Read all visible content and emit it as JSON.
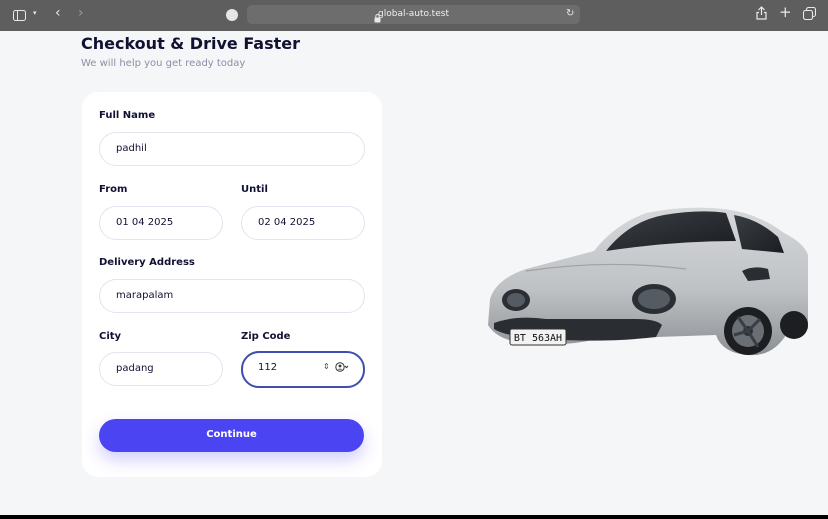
{
  "browser": {
    "url": "global-auto.test",
    "icons": {
      "sidebar": "sidebar-icon",
      "back": "back-icon",
      "forward": "forward-icon",
      "reload": "reload-icon",
      "share": "share-icon",
      "new_tab": "plus-icon",
      "tabs": "tabs-overview-icon"
    }
  },
  "page": {
    "title": "Checkout & Drive Faster",
    "subtitle": "We will help you get ready today"
  },
  "form": {
    "full_name_label": "Full Name",
    "full_name_value": "padhil",
    "from_label": "From",
    "from_value": "01 04 2025",
    "until_label": "Until",
    "until_value": "02 04 2025",
    "address_label": "Delivery Address",
    "address_value": "marapalam",
    "city_label": "City",
    "city_value": "padang",
    "zip_label": "Zip Code",
    "zip_value": "112",
    "continue_label": "Continue"
  },
  "car": {
    "plate": "BT 563AH",
    "color": "#c9ccd0"
  },
  "colors": {
    "accent": "#4b44f2",
    "title": "#111133",
    "background": "#f4f6f7"
  }
}
